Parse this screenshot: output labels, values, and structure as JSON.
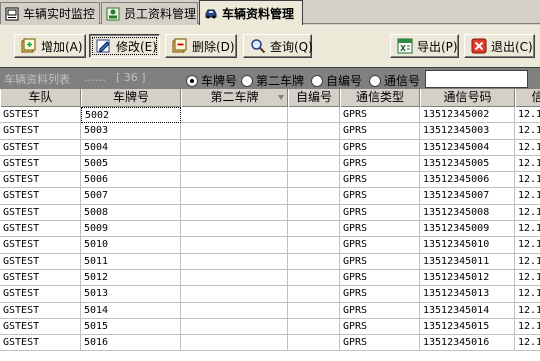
{
  "tabs": [
    {
      "label": "车辆实时监控",
      "icon": "monitor-icon"
    },
    {
      "label": "员工资料管理",
      "icon": "employee-icon"
    },
    {
      "label": "车辆资料管理",
      "icon": "car-icon",
      "active": true
    }
  ],
  "toolbar": {
    "add_label": "增加(A)",
    "edit_label": "修改(E)",
    "delete_label": "删除(D)",
    "query_label": "查询(Q)",
    "export_label": "导出(P)",
    "exit_label": "退出(C)"
  },
  "filter": {
    "list_caption": "车辆资料列表",
    "list_dots": "……",
    "list_count": "[ 36 ]",
    "options": [
      "车牌号",
      "第二车牌",
      "自编号",
      "通信号"
    ],
    "selected": "车牌号",
    "search_value": ""
  },
  "table": {
    "columns": [
      "车队",
      "车牌号",
      "第二车牌",
      "自编号",
      "通信类型",
      "通信号码",
      "信"
    ],
    "rows": [
      [
        "GSTEST",
        "5002",
        "",
        "",
        "GPRS",
        "13512345002",
        "12.1"
      ],
      [
        "GSTEST",
        "5003",
        "",
        "",
        "GPRS",
        "13512345003",
        "12.1"
      ],
      [
        "GSTEST",
        "5004",
        "",
        "",
        "GPRS",
        "13512345004",
        "12.1"
      ],
      [
        "GSTEST",
        "5005",
        "",
        "",
        "GPRS",
        "13512345005",
        "12.1"
      ],
      [
        "GSTEST",
        "5006",
        "",
        "",
        "GPRS",
        "13512345006",
        "12.1"
      ],
      [
        "GSTEST",
        "5007",
        "",
        "",
        "GPRS",
        "13512345007",
        "12.1"
      ],
      [
        "GSTEST",
        "5008",
        "",
        "",
        "GPRS",
        "13512345008",
        "12.1"
      ],
      [
        "GSTEST",
        "5009",
        "",
        "",
        "GPRS",
        "13512345009",
        "12.1"
      ],
      [
        "GSTEST",
        "5010",
        "",
        "",
        "GPRS",
        "13512345010",
        "12.1"
      ],
      [
        "GSTEST",
        "5011",
        "",
        "",
        "GPRS",
        "13512345011",
        "12.1"
      ],
      [
        "GSTEST",
        "5012",
        "",
        "",
        "GPRS",
        "13512345012",
        "12.1"
      ],
      [
        "GSTEST",
        "5013",
        "",
        "",
        "GPRS",
        "13512345013",
        "12.1"
      ],
      [
        "GSTEST",
        "5014",
        "",
        "",
        "GPRS",
        "13512345014",
        "12.1"
      ],
      [
        "GSTEST",
        "5015",
        "",
        "",
        "GPRS",
        "13512345015",
        "12.1"
      ],
      [
        "GSTEST",
        "5016",
        "",
        "",
        "GPRS",
        "13512345016",
        "12.1"
      ]
    ]
  }
}
